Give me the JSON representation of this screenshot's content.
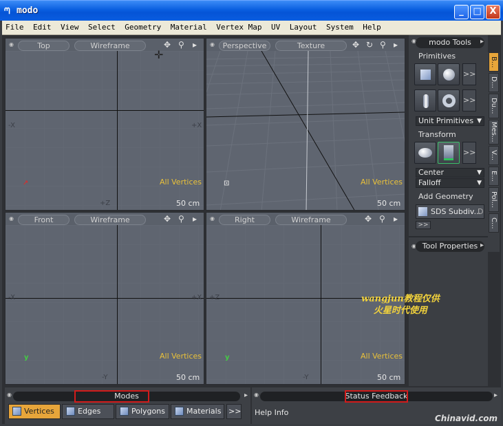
{
  "window": {
    "title": "modo",
    "minimize": "_",
    "maximize": "□",
    "close": "X"
  },
  "menu": [
    "File",
    "Edit",
    "View",
    "Select",
    "Geometry",
    "Material",
    "Vertex Map",
    "UV",
    "Layout",
    "System",
    "Help"
  ],
  "viewports": {
    "top": {
      "view": "Top",
      "shading": "Wireframe",
      "status": "All Vertices",
      "scale": "50 cm",
      "neg_x": "-X",
      "pos_x": "+X",
      "pos_z": "+Z"
    },
    "perspective": {
      "view": "Perspective",
      "shading": "Texture",
      "status": "All Vertices",
      "scale": "50 cm"
    },
    "front": {
      "view": "Front",
      "shading": "Wireframe",
      "status": "All Vertices",
      "scale": "50 cm",
      "neg_x": "-X",
      "pos_x": "+X",
      "neg_y": "-Y"
    },
    "right": {
      "view": "Right",
      "shading": "Wireframe",
      "status": "All Vertices",
      "scale": "50 cm",
      "pos_z": "+Z",
      "neg_y": "-Y"
    }
  },
  "tools_panel": {
    "header": "modo Tools",
    "primitives_label": "Primitives",
    "unit_primitives": "Unit Primitives",
    "transform_label": "Transform",
    "center": "Center",
    "falloff": "Falloff",
    "add_geometry_label": "Add Geometry",
    "sds_subdiv": "SDS Subdiv...",
    "sds_key": "D",
    "more": ">>"
  },
  "tool_properties": "Tool Properties",
  "side_tabs": [
    "B...",
    "D...",
    "Du...",
    "Mes...",
    "V...",
    "E...",
    "Pol...",
    "C..."
  ],
  "modes_panel": {
    "header": "Modes",
    "buttons": [
      "Vertices",
      "Edges",
      "Polygons",
      "Materials"
    ],
    "more": ">>"
  },
  "status_panel": {
    "header": "Status Feedback",
    "help": "Help Info"
  },
  "watermark": {
    "line1": "wangjun教程仅供",
    "line2": "火星时代使用"
  },
  "brand": "Chinavid.com",
  "colors": {
    "accent": "#e7a53a",
    "status_text": "#e9c13a",
    "highlight_box": "#d21b1b"
  }
}
